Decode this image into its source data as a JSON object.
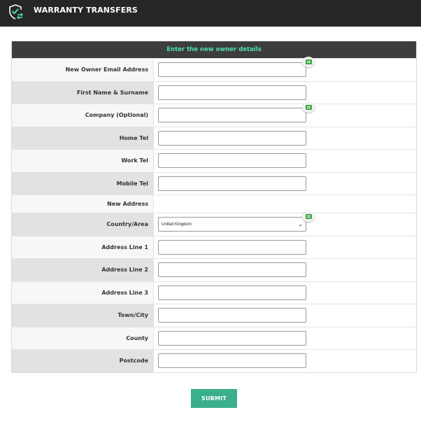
{
  "header": {
    "title": "WARRANTY TRANSFERS",
    "logo_icon": "shield-check-transfer-icon"
  },
  "form": {
    "heading": "Enter the new owner details",
    "fields": [
      {
        "label": "New Owner Email Address",
        "value": "",
        "type": "text",
        "autofill_badge": true
      },
      {
        "label": "First Name & Surname",
        "value": "",
        "type": "text"
      },
      {
        "label": "Company (Optional)",
        "value": "",
        "type": "text",
        "autofill_badge": true
      },
      {
        "label": "Home Tel",
        "value": "",
        "type": "text"
      },
      {
        "label": "Work Tel",
        "value": "",
        "type": "text"
      },
      {
        "label": "Mobile Tel",
        "value": "",
        "type": "text"
      },
      {
        "label": "New Address",
        "type": "section"
      },
      {
        "label": "Country/Area",
        "value": "United Kingdom",
        "type": "select",
        "autofill_badge": true
      },
      {
        "label": "Address Line 1",
        "value": "",
        "type": "text"
      },
      {
        "label": "Address Line 2",
        "value": "",
        "type": "text"
      },
      {
        "label": "Address Line 3",
        "value": "",
        "type": "text"
      },
      {
        "label": "Town/City",
        "value": "",
        "type": "text"
      },
      {
        "label": "County",
        "value": "",
        "type": "text"
      },
      {
        "label": "Postcode",
        "value": "",
        "type": "text"
      }
    ]
  },
  "submit_label": "SUBMIT",
  "colors": {
    "topbar": "#262626",
    "heading_text": "#4fe0b0",
    "submit": "#3aaf8c",
    "autofill_icon": "#3aa33f"
  }
}
